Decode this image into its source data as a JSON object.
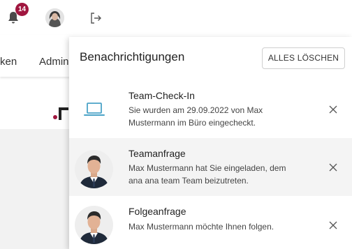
{
  "topbar": {
    "notification_count": "14",
    "icons": [
      "bell-icon",
      "user-avatar",
      "logout-icon"
    ]
  },
  "nav": {
    "items": [
      {
        "label": "ken"
      },
      {
        "label": "Admini"
      }
    ]
  },
  "panel": {
    "title": "Benachrichtigungen",
    "clear_all_label": "ALLES LÖSCHEN",
    "notifications": [
      {
        "icon": "laptop-icon",
        "title": "Team-Check-In",
        "body": "Sie wurden am 29.09.2022 von Max Mustermann im Büro eingecheckt."
      },
      {
        "icon": "user-avatar",
        "title": "Teamanfrage",
        "body": "Max Mustermann hat Sie eingeladen, dem ana ana team Team beizutreten."
      },
      {
        "icon": "user-avatar",
        "title": "Folgeanfrage",
        "body": "Max Mustermann möchte Ihnen folgen."
      }
    ]
  },
  "colors": {
    "badge": "#a0163f",
    "laptop_icon": "#4aa3c7",
    "accent_logo": "#a0163f"
  }
}
